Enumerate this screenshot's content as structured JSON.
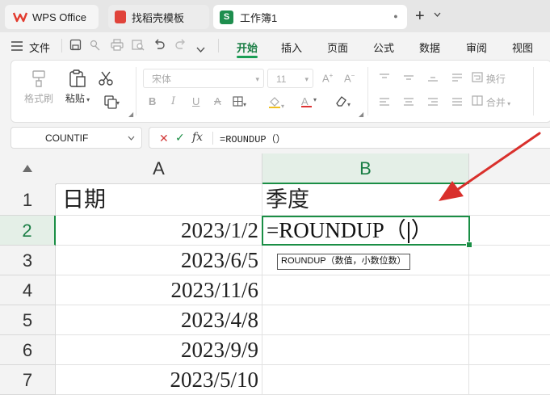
{
  "titlebar": {
    "tabs": [
      {
        "label": "WPS Office"
      },
      {
        "label": "找稻壳模板"
      },
      {
        "label": "工作簿1"
      }
    ],
    "app_logo_letter": "S",
    "close_glyph": "●",
    "new_tab_glyph": "+",
    "new_tab_dropdown_glyph": "⌄"
  },
  "menu": {
    "file_label": "文件",
    "tabs": [
      {
        "label": "开始",
        "active": true
      },
      {
        "label": "插入"
      },
      {
        "label": "页面"
      },
      {
        "label": "公式"
      },
      {
        "label": "数据"
      },
      {
        "label": "审阅"
      },
      {
        "label": "视图"
      }
    ]
  },
  "ribbon": {
    "format_painter": "格式刷",
    "paste": "粘贴",
    "font_name": "宋体",
    "font_size": "11",
    "wrap_text": "换行",
    "merge": "合并"
  },
  "formula_bar": {
    "name_box": "COUNTIF",
    "formula": "=ROUNDUP（）"
  },
  "sheet": {
    "columns": [
      "A",
      "B"
    ],
    "rows": [
      "1",
      "2",
      "3",
      "4",
      "5",
      "6",
      "7"
    ],
    "selected_row": "2",
    "selected_column": "B",
    "cells_a": [
      "日期",
      "2023/1/2",
      "2023/6/5",
      "2023/11/6",
      "2023/4/8",
      "2023/9/9",
      "2023/5/10"
    ],
    "cell_b1": "季度",
    "active_cell_prefix": "=ROUNDUP（",
    "active_cell_suffix": "）",
    "tooltip": "ROUNDUP（数值，小数位数）"
  },
  "colors": {
    "accent": "#1a8e45",
    "arrow": "#d9302c"
  }
}
